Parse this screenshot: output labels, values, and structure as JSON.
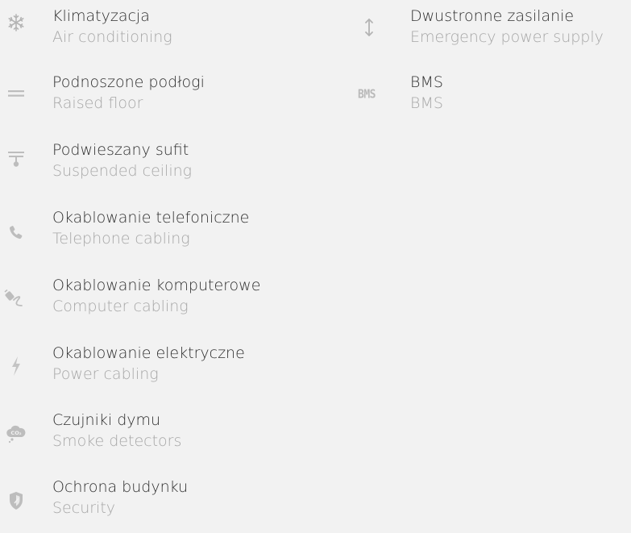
{
  "features_left": [
    {
      "icon": "snowflake-icon",
      "pl": "Klimatyzacja",
      "en": "Air conditioning"
    },
    {
      "icon": "double-line-icon",
      "pl": "Podnoszone podłogi",
      "en": "Raised floor"
    },
    {
      "icon": "ceiling-lamp-icon",
      "pl": "Podwieszany sufit",
      "en": "Suspended ceiling"
    },
    {
      "icon": "phone-icon",
      "pl": "Okablowanie telefoniczne",
      "en": "Telephone cabling"
    },
    {
      "icon": "cable-plug-icon",
      "pl": "Okablowanie komputerowe",
      "en": "Computer cabling"
    },
    {
      "icon": "lightning-icon",
      "pl": "Okablowanie elektryczne",
      "en": "Power cabling"
    },
    {
      "icon": "co-cloud-icon",
      "pl": "Czujniki dymu",
      "en": "Smoke detectors"
    },
    {
      "icon": "shield-icon",
      "pl": "Ochrona budynku",
      "en": "Security"
    }
  ],
  "features_right": [
    {
      "icon": "up-down-arrow-icon",
      "pl": "Dwustronne zasilanie",
      "en": "Emergency power supply"
    },
    {
      "icon": "bms-icon",
      "icon_text": "BMS",
      "pl": "BMS",
      "en": "BMS"
    }
  ]
}
